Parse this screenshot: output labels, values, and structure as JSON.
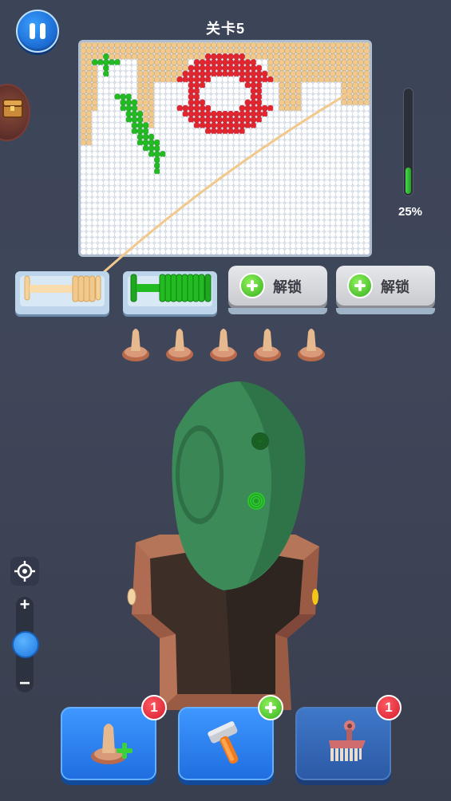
{
  "hud": {
    "level_title": "关卡5",
    "progress_percent": 25,
    "progress_label": "25%"
  },
  "icons": {
    "pause": "pause-icon",
    "chest": "treasure-chest-icon",
    "locate": "crosshair-icon"
  },
  "slots": [
    {
      "type": "spool",
      "color": "#f2c98c",
      "filled": true
    },
    {
      "type": "spool",
      "color": "#22bb22",
      "filled": true
    }
  ],
  "unlock_buttons": [
    {
      "label": "解锁"
    },
    {
      "label": "解锁"
    }
  ],
  "zoom": {
    "plus_label": "+",
    "minus_label": "−",
    "level": 0.45
  },
  "tools": [
    {
      "icon": "add-peg-icon",
      "badge": "1",
      "badge_type": "count"
    },
    {
      "icon": "hammer-icon",
      "badge": "",
      "badge_type": "plus"
    },
    {
      "icon": "brush-icon",
      "badge": "1",
      "badge_type": "count"
    }
  ],
  "colors": {
    "cream": "#f2c98c",
    "green": "#22bb22",
    "red": "#e3252f",
    "white_yarn": "#ffffff",
    "accent_blue": "#1f6ee0"
  }
}
